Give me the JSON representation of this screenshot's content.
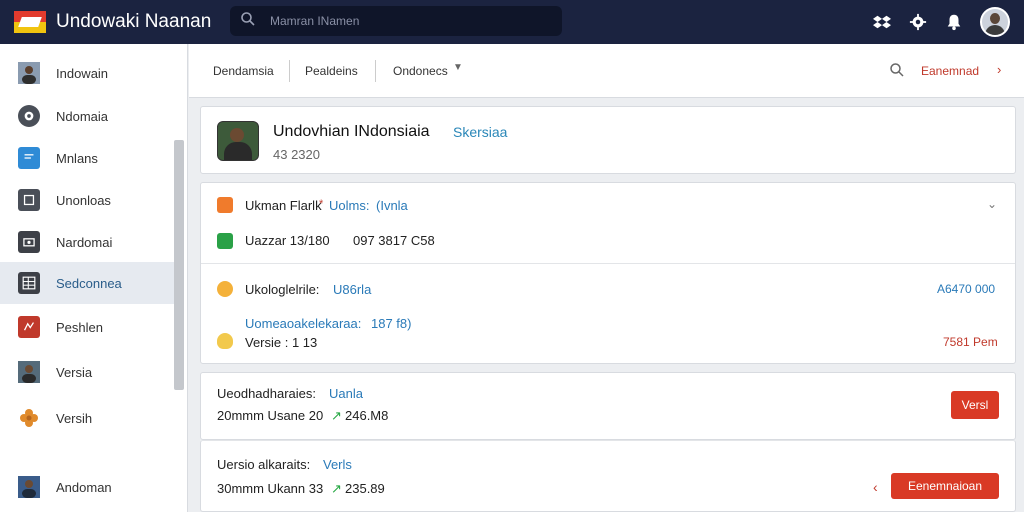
{
  "app": {
    "title": "Undowaki Naanan"
  },
  "search": {
    "placeholder": "Mamran INamen"
  },
  "sidebar": {
    "items": [
      {
        "label": "Indowain",
        "icon": "user-photo-icon"
      },
      {
        "label": "Ndomaia",
        "icon": "gear-icon"
      },
      {
        "label": "Mnlans",
        "icon": "chat-icon"
      },
      {
        "label": "Unonloas",
        "icon": "box-icon"
      },
      {
        "label": "Nardomai",
        "icon": "camera-icon"
      },
      {
        "label": "Sedconnea",
        "icon": "table-icon"
      },
      {
        "label": "Peshlen",
        "icon": "chart-icon"
      },
      {
        "label": "Versia",
        "icon": "user-photo-icon"
      },
      {
        "label": "Versih",
        "icon": "flower-icon"
      },
      {
        "label": "Andoman",
        "icon": "user-photo-icon"
      }
    ]
  },
  "tabs": {
    "items": [
      "Dendamsia",
      "Pealdeins",
      "Ondonecs"
    ],
    "right_link": "Eanemnad"
  },
  "profile": {
    "name": "Undovhian INdonsiaia",
    "tag": "Skersiaa",
    "sub": "43 2320"
  },
  "details": {
    "row1_label": "Ukman Flarlk",
    "row1_mid": "Uolms:",
    "row1_value": "(Ivnla",
    "row2_label": "Uazzar 13/180",
    "row2_value": "097 3817 C58",
    "row3_label": "Ukologlelrile:",
    "row3_value": "U86rla",
    "row3_right": "A6470 000",
    "row4_label": "Uomeaoakelekaraa:",
    "row4_value": "187 f8)",
    "row5_label": "Versie : 1 13",
    "row5_right": "7581 Pem"
  },
  "transactions": [
    {
      "label": "Ueodhadharaies:",
      "tag": "Uanla",
      "line": "20mmm  Usane 20",
      "amount": "246.M8",
      "button": "Versl"
    },
    {
      "label": "Uersio alkaraits:",
      "tag": "Verls",
      "line": "30mmm  Ukann 33",
      "amount": "235.89",
      "button": "Eenemnaioan"
    }
  ],
  "colors": {
    "topbar": "#1b2340",
    "accent_red": "#d93a25",
    "accent_blue": "#2a7ab8",
    "active_item": "#e6eaf0"
  }
}
